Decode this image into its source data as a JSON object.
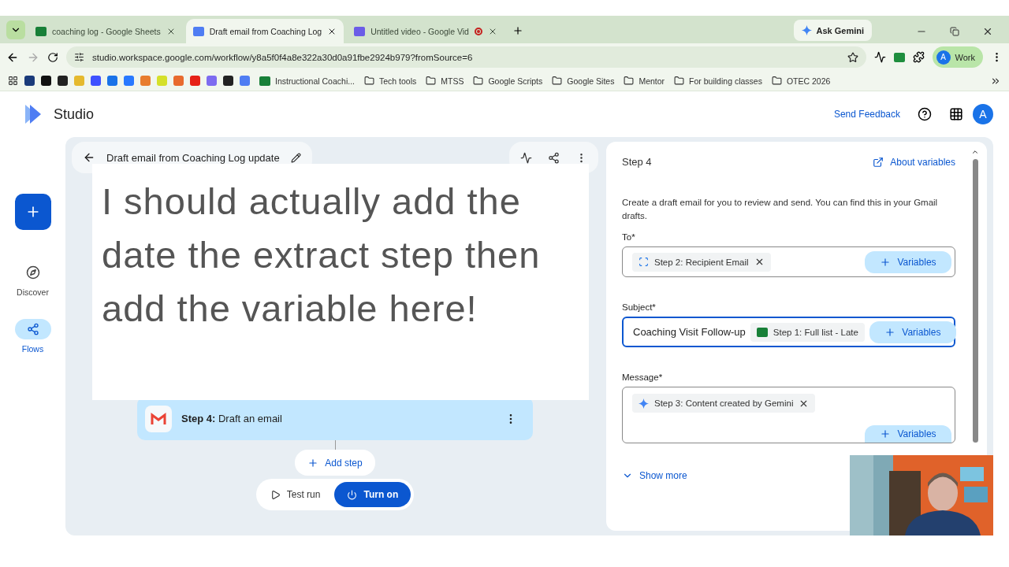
{
  "browser": {
    "tabs": [
      {
        "title": "coaching log - Google Sheets",
        "kind": "sheets",
        "selected": false,
        "recording": false
      },
      {
        "title": "Draft email from Coaching Log",
        "kind": "studio",
        "selected": true,
        "recording": false
      },
      {
        "title": "Untitled video - Google Vid",
        "kind": "vids",
        "selected": false,
        "recording": true
      }
    ],
    "ask_gemini": "Ask Gemini",
    "url": "studio.workspace.google.com/workflow/y8a5f0f4a8e322a30d0a91fbe2924b979?fromSource=6",
    "profile": {
      "initial": "A",
      "label": "Work"
    },
    "bookmarks": [
      {
        "label": "Instructional Coachi...",
        "kind": "sheet"
      },
      {
        "label": "Tech tools",
        "kind": "folder"
      },
      {
        "label": "MTSS",
        "kind": "folder"
      },
      {
        "label": "Google Scripts",
        "kind": "folder"
      },
      {
        "label": "Google Sites",
        "kind": "folder"
      },
      {
        "label": "Mentor",
        "kind": "folder"
      },
      {
        "label": "For building classes",
        "kind": "folder"
      },
      {
        "label": "OTEC 2026",
        "kind": "folder"
      }
    ]
  },
  "app": {
    "title": "Studio",
    "send_feedback": "Send Feedback",
    "avatar": "A"
  },
  "nav": [
    {
      "label": "Discover",
      "kind": "compass",
      "selected": false
    },
    {
      "label": "Flows",
      "kind": "flows",
      "selected": true
    }
  ],
  "flow": {
    "title": "Draft email from Coaching Log update",
    "note": "I should actually add the date the extract step then add the variable here!",
    "step": {
      "prefix": "Step 4:",
      "name": "Draft an email"
    },
    "add_step": "Add step",
    "test_run": "Test run",
    "turn_on": "Turn on"
  },
  "panel": {
    "step_label": "Step 4",
    "about_variables": "About variables",
    "description": "Create a draft email for you to review and send. You can find this in your Gmail drafts.",
    "fields": [
      {
        "label": "To*",
        "focused": false,
        "multiline": false,
        "chips": [
          {
            "text": "Step 2: Recipient Email",
            "kind": "variable"
          }
        ],
        "button": "Variables"
      },
      {
        "label": "Subject*",
        "focused": true,
        "multiline": false,
        "value": "Coaching Visit Follow-up",
        "chips": [
          {
            "text": "Step 1: Full list - Late",
            "kind": "sheet"
          }
        ],
        "button": "Variables"
      },
      {
        "label": "Message*",
        "focused": false,
        "multiline": true,
        "chips": [
          {
            "text": "Step 3: Content created by Gemini",
            "kind": "gemini"
          }
        ],
        "button": "Variables"
      }
    ],
    "show_more": "Show more"
  }
}
